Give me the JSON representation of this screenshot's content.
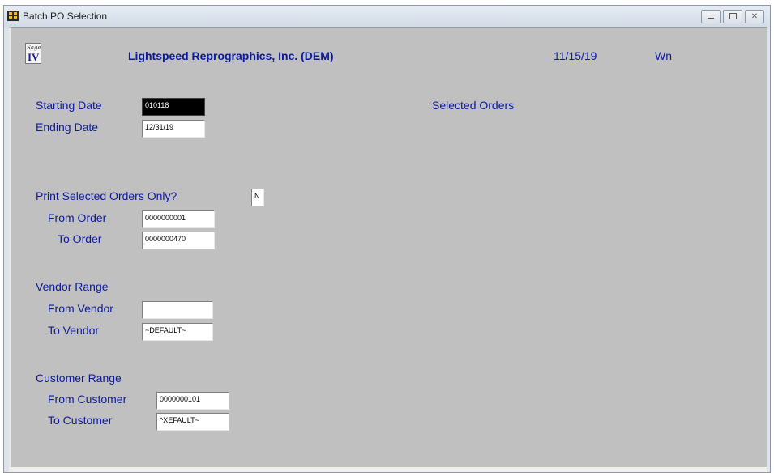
{
  "window": {
    "title": "Batch PO Selection"
  },
  "header": {
    "company": "Lightspeed Reprographics, Inc. (DEM)",
    "date": "11/15/19",
    "user": "Wn"
  },
  "logo": {
    "script": "Sage",
    "numeral": "IV"
  },
  "form": {
    "starting_date": {
      "label": "Starting Date",
      "value": "010118"
    },
    "ending_date": {
      "label": "Ending Date",
      "value": "12/31/19"
    },
    "selected_orders_label": "Selected Orders",
    "print_selected": {
      "label": "Print Selected Orders Only?",
      "value": "N"
    },
    "from_order": {
      "label": "From Order",
      "value": "0000000001"
    },
    "to_order": {
      "label": "To Order",
      "value": "0000000470"
    },
    "vendor_range_label": "Vendor Range",
    "from_vendor": {
      "label": "From Vendor",
      "value": ""
    },
    "to_vendor": {
      "label": "To Vendor",
      "value": "~DEFAULT~"
    },
    "customer_range_label": "Customer Range",
    "from_customer": {
      "label": "From Customer",
      "value": "0000000101"
    },
    "to_customer": {
      "label": "To Customer",
      "value": "^XEFAULT~"
    }
  },
  "icons": {
    "app": "batch-window-icon",
    "minimize": "minimize-icon",
    "restore": "restore-icon",
    "close": "close-icon"
  },
  "colors": {
    "label_text": "#0b1a9e",
    "client_bg": "#c0c0c0",
    "active_field": "#000000"
  }
}
